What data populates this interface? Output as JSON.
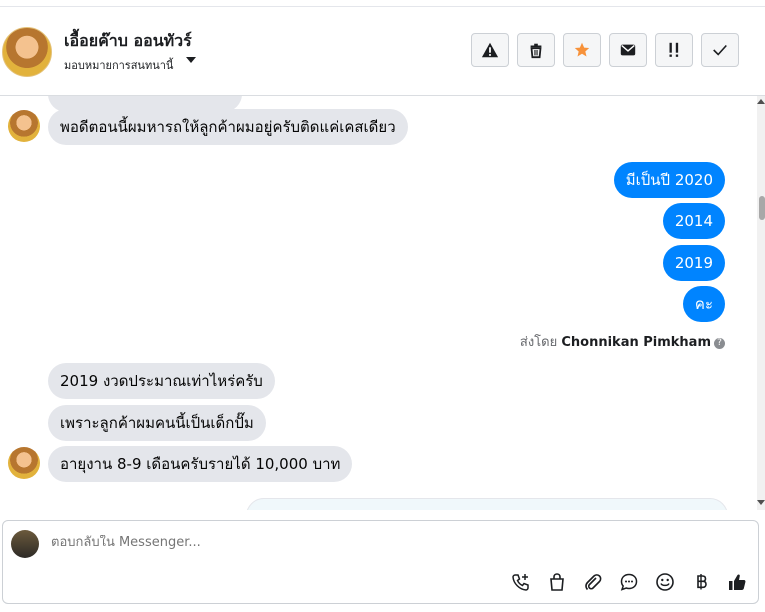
{
  "header": {
    "name": "เอื้อยค๊าบ ออนทัวร์",
    "assign_label": "มอบหมายการสนทนานี้",
    "actions": [
      {
        "icon": "warning-icon"
      },
      {
        "icon": "trash-icon"
      },
      {
        "icon": "star-icon"
      },
      {
        "icon": "envelope-icon"
      },
      {
        "icon": "follow-up-icon"
      },
      {
        "icon": "check-icon"
      }
    ],
    "star_color": "#f7923a"
  },
  "messages": [
    {
      "dir": "in",
      "text": "พอดีตอนนี้ผมหารถให้ลูกค้าผมอยู่ครับติดแค่เคสเดียว"
    },
    {
      "dir": "out",
      "text": "มีเป็นปี 2020"
    },
    {
      "dir": "out",
      "text": "2014"
    },
    {
      "dir": "out",
      "text": "2019"
    },
    {
      "dir": "out",
      "text": "คะ"
    },
    {
      "dir": "in",
      "text": "2019 งวดประมาณเท่าไหร่ครับ"
    },
    {
      "dir": "in",
      "text": "เพราะลูกค้าผมคนนี้เป็นเด็กปั๊ม"
    },
    {
      "dir": "in",
      "text": "อายุงาน 8-9 เดือนครับรายได้ 10,000 บาท"
    }
  ],
  "sent_by": {
    "prefix": "ส่งโดย",
    "name": "Chonnikan Pimkham"
  },
  "composer": {
    "placeholder": "ตอบกลับใน Messenger..."
  },
  "toolbar": [
    "phone-add-icon",
    "shopping-bag-icon",
    "paperclip-icon",
    "saved-reply-icon",
    "emoji-icon",
    "baht-icon",
    "like-icon"
  ],
  "colors": {
    "outgoing": "#0084ff",
    "incoming": "#e4e6eb"
  }
}
